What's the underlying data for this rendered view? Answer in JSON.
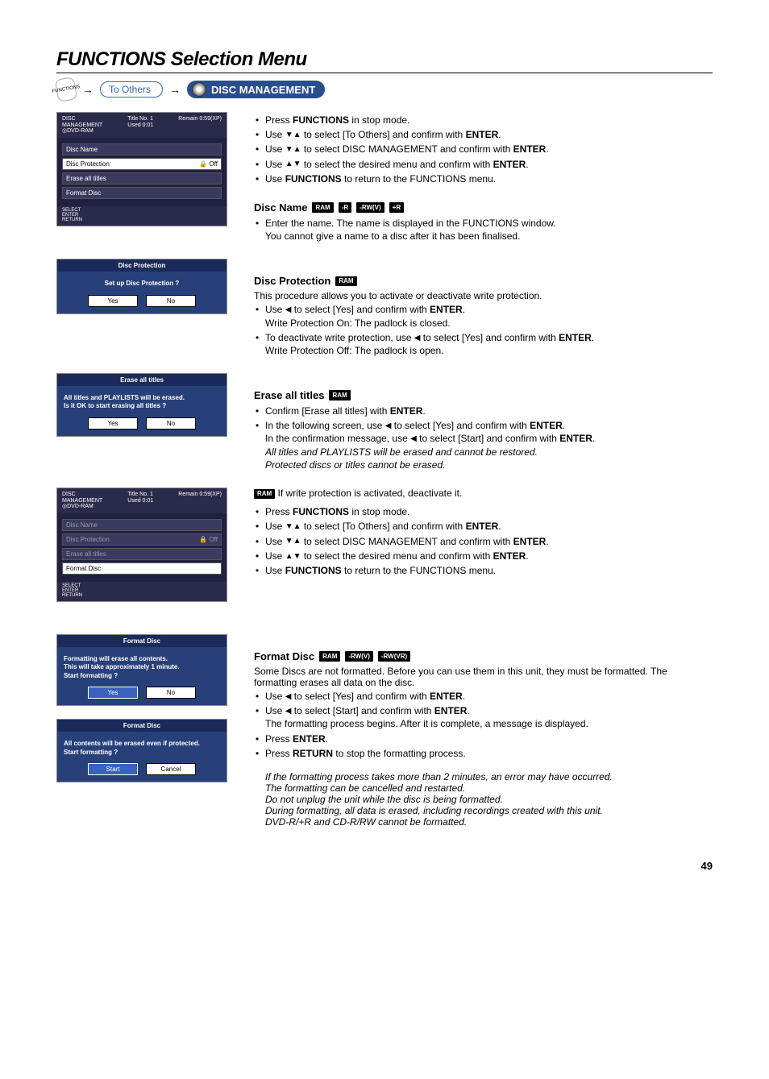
{
  "page": {
    "title": "FUNCTIONS Selection Menu",
    "number": "49"
  },
  "topline": {
    "remote": "FUNCTIONS",
    "toOthers": "To Others",
    "discMgmt": "DISC MANAGEMENT"
  },
  "intro": {
    "b1_pre": "Press ",
    "b1_key": "FUNCTIONS",
    "b1_post": " in stop mode.",
    "b2_pre": "Use ",
    "b2_mid": " to select [To Others] and confirm with ",
    "b2_key": "ENTER",
    "b2_post": ".",
    "b3_pre": "Use ",
    "b3_mid": " to select DISC MANAGEMENT and confirm with ",
    "b3_key": "ENTER",
    "b3_post": ".",
    "b4_pre": "Use ",
    "b4_mid": " to select the desired menu and confirm with ",
    "b4_key": "ENTER",
    "b4_post": ".",
    "b5_pre": "Use ",
    "b5_key": "FUNCTIONS",
    "b5_post": " to return to the FUNCTIONS menu."
  },
  "discName": {
    "heading": "Disc Name",
    "badges": [
      "RAM",
      "-R",
      "-RW(V)",
      "+R"
    ],
    "line1": "Enter the name. The name is displayed in the FUNCTIONS window.",
    "line2": "You cannot give a name to a disc after it has been finalised."
  },
  "discProt": {
    "heading": "Disc Protection",
    "badges": [
      "RAM"
    ],
    "p1": "This procedure allows you to activate or deactivate write protection.",
    "b1_pre": "Use ",
    "b1_mid": " to select [Yes] and confirm with ",
    "b1_key": "ENTER",
    "b1_post": ".",
    "b1_line2": "Write Protection On: The padlock is closed.",
    "b2_pre": "To deactivate write protection, use ",
    "b2_mid": " to select [Yes] and confirm with ",
    "b2_key": "ENTER",
    "b2_post": ".",
    "b2_line2": "Write Protection Off: The padlock is open."
  },
  "eraseAll": {
    "heading": "Erase all titles",
    "badges": [
      "RAM"
    ],
    "b1_pre": "Confirm [Erase all titles] with ",
    "b1_key": "ENTER",
    "b1_post": ".",
    "b2_pre": "In the following screen, use ",
    "b2_mid": " to select [Yes] and confirm with ",
    "b2_key": "ENTER",
    "b2_post": ".",
    "b2_line2a": "In the confirmation message, use ",
    "b2_line2b": " to select [Start] and confirm with ",
    "b2_key2": "ENTER",
    "b2_line2c": ".",
    "it1": "All titles and PLAYLISTS will be erased and cannot be restored.",
    "it2": "Protected discs or titles cannot be erased."
  },
  "writeProtNote": {
    "badge": "RAM",
    "text": " If write protection is activated, deactivate it."
  },
  "repeat": {
    "b1_pre": "Press ",
    "b1_key": "FUNCTIONS",
    "b1_post": " in stop mode.",
    "b2_pre": "Use ",
    "b2_mid": " to select [To Others] and confirm with ",
    "b2_key": "ENTER",
    "b2_post": ".",
    "b3_pre": "Use ",
    "b3_mid": " to select DISC MANAGEMENT and confirm with ",
    "b3_key": "ENTER",
    "b3_post": ".",
    "b4_pre": "Use ",
    "b4_mid": " to select the desired menu and confirm with ",
    "b4_key": "ENTER",
    "b4_post": ".",
    "b5_pre": "Use ",
    "b5_key": "FUNCTIONS",
    "b5_post": " to return to the FUNCTIONS menu."
  },
  "formatDisc": {
    "heading": "Format Disc",
    "badges": [
      "RAM",
      "-RW(V)",
      "-RW(VR)"
    ],
    "p1": "Some Discs are not formatted. Before you can use them in this unit, they must be formatted. The formatting erases all data on the disc.",
    "b1_pre": "Use ",
    "b1_mid": " to select [Yes] and confirm with ",
    "b1_key": "ENTER",
    "b1_post": ".",
    "b2_pre": "Use ",
    "b2_mid": " to select [Start] and confirm with ",
    "b2_key": "ENTER",
    "b2_post": ".",
    "b2_line2": "The formatting process begins. After it is complete, a message is displayed.",
    "b3_pre": "Press ",
    "b3_key": "ENTER",
    "b3_post": ".",
    "b4_pre": "Press ",
    "b4_key": "RETURN",
    "b4_post": " to stop the formatting process.",
    "it1": "If the formatting process takes more than 2 minutes, an error may have occurred.",
    "it2": "The formatting can be cancelled and restarted.",
    "it3": "Do not unplug the unit while the disc is being formatted.",
    "it4": "During formatting, all data is erased, including recordings created with this unit.",
    "it5": "DVD-R/+R and CD-R/RW cannot be formatted."
  },
  "shot1": {
    "headL": "DISC\nMANAGEMENT",
    "discType": "DVD-RAM",
    "titleNo": "Title No.   1",
    "used": "Used    0:01",
    "remain": "Remain    0:59(XP)",
    "items": [
      "Disc Name",
      "Disc Protection",
      "Erase all titles",
      "Format Disc"
    ],
    "selected": 1,
    "off": "Off",
    "foot": "SELECT\nENTER\n    RETURN"
  },
  "modalProt": {
    "title": "Disc Protection",
    "msg": "Set up Disc Protection ?",
    "yes": "Yes",
    "no": "No"
  },
  "modalErase": {
    "title": "Erase all titles",
    "msg": "All titles and PLAYLISTS will be erased.\nIs it OK to start erasing all titles ?",
    "yes": "Yes",
    "no": "No"
  },
  "shot2": {
    "headL": "DISC\nMANAGEMENT",
    "discType": "DVD-RAM",
    "titleNo": "Title No.   1",
    "used": "Used    0:01",
    "remain": "Remain    0:59(XP)",
    "items": [
      "Disc Name",
      "Disc Protection",
      "Erase all titles",
      "Format Disc"
    ],
    "selected": 3,
    "off": "Off",
    "foot": "SELECT\nENTER\n    RETURN"
  },
  "modalFmt1": {
    "title": "Format Disc",
    "msg": "Formatting will erase all contents.\nThis will take approximately 1 minute.\nStart formatting ?",
    "yes": "Yes",
    "no": "No"
  },
  "modalFmt2": {
    "title": "Format Disc",
    "msg": "All contents will be erased even if protected.\nStart formatting ?",
    "start": "Start",
    "cancel": "Cancel"
  }
}
